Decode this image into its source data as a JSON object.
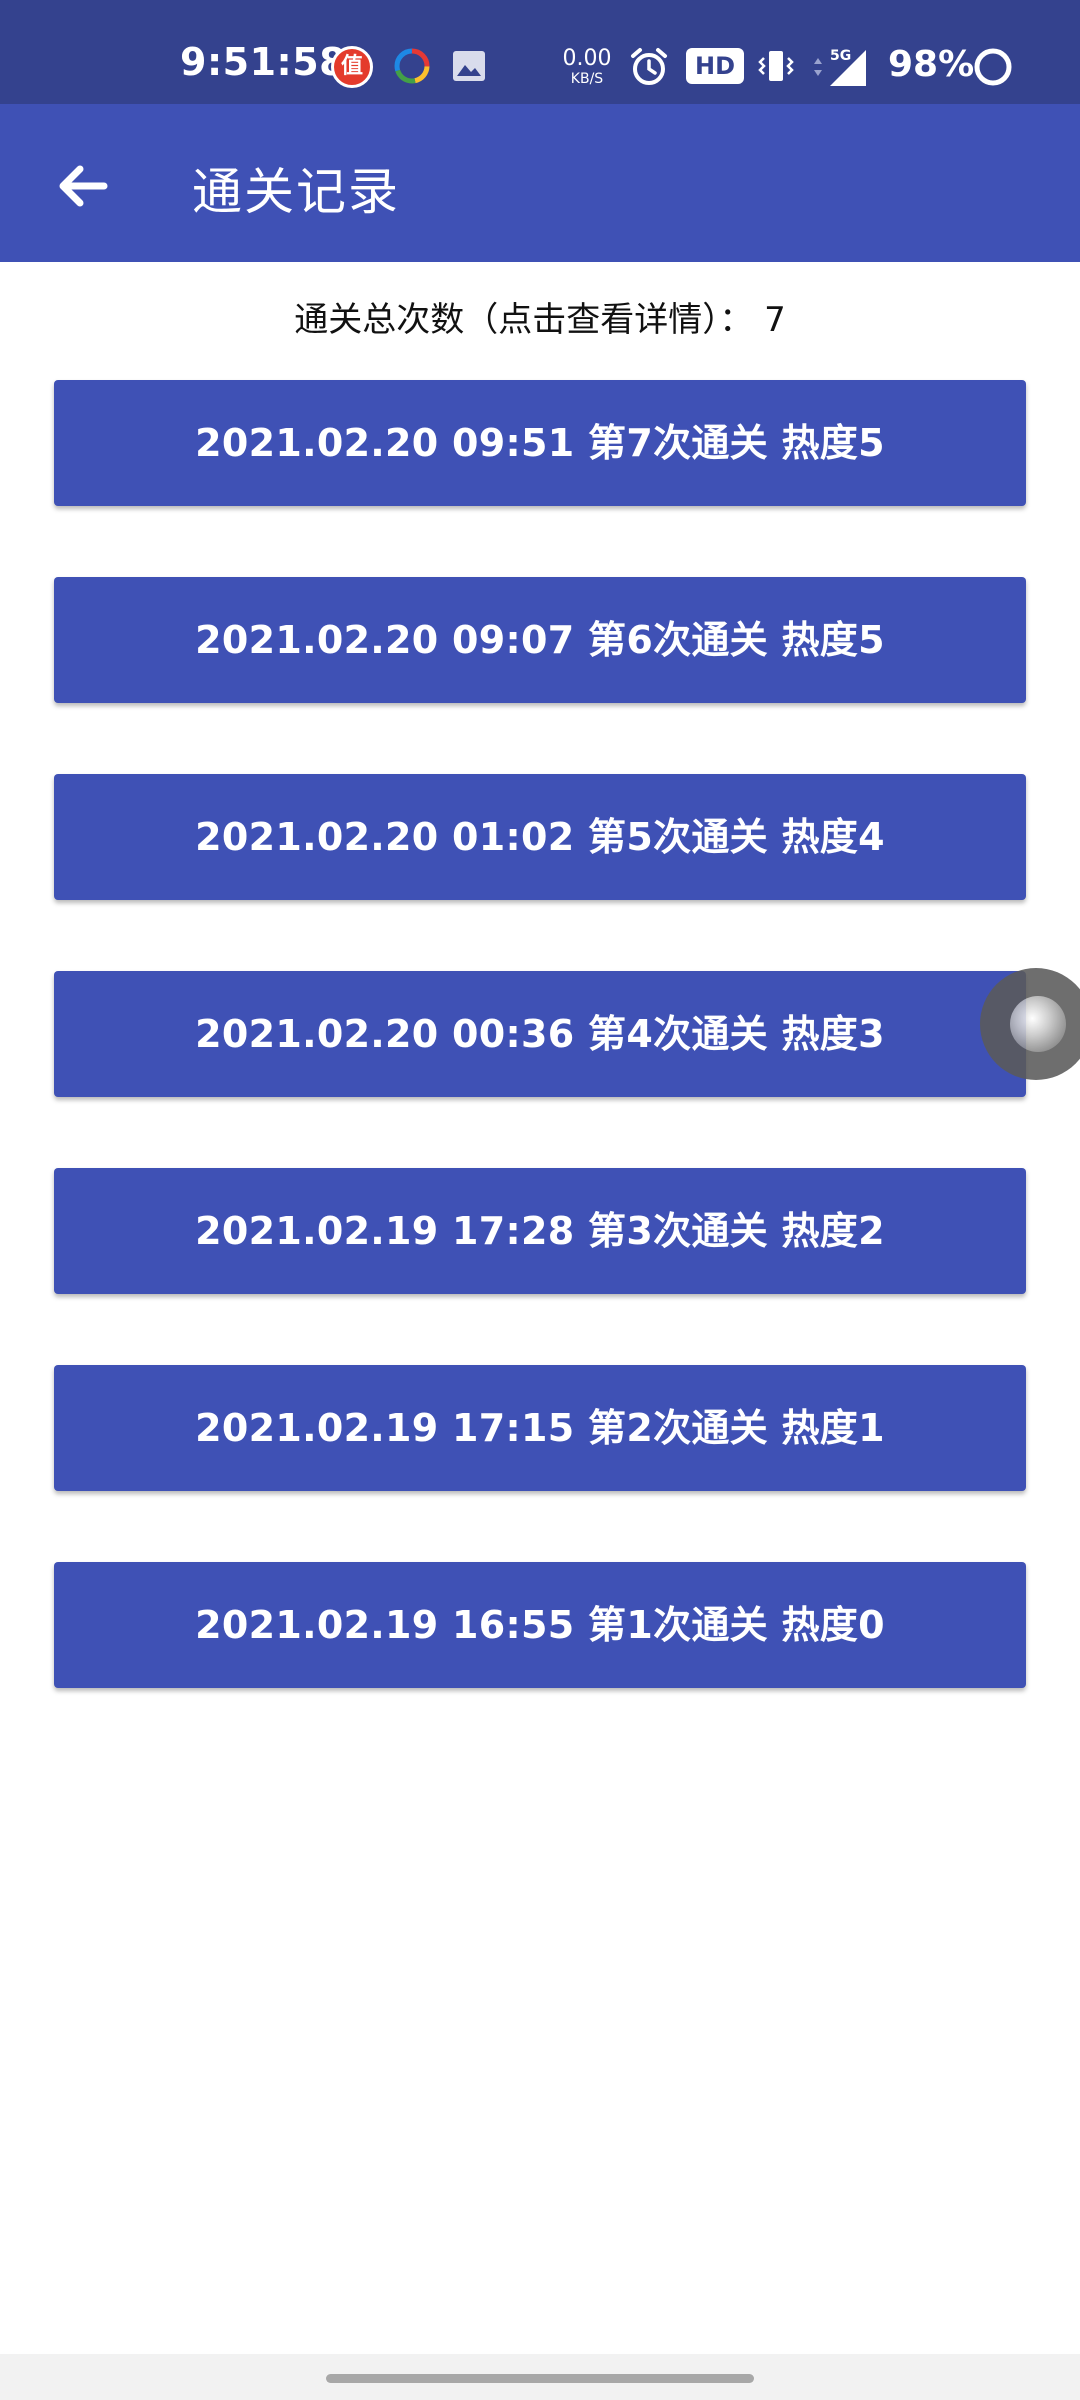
{
  "status_bar": {
    "time": "9:51:58",
    "zhi_badge": "值",
    "net_speed_value": "0.00",
    "net_speed_unit": "KB/S",
    "hd_badge": "HD",
    "signal_label": "5G",
    "battery_percent": "98%",
    "icons": [
      "zhi-app-icon",
      "ring-app-icon",
      "image-icon",
      "alarm-icon",
      "vibrate-icon",
      "signal-icon",
      "battery-icon"
    ]
  },
  "app_bar": {
    "back_icon": "arrow-left-icon",
    "title": "通关记录"
  },
  "summary": {
    "text": "通关总次数（点击查看详情）：  7"
  },
  "records": [
    {
      "label": "2021.02.20 09:51 第7次通关 热度5"
    },
    {
      "label": "2021.02.20 09:07 第6次通关 热度5"
    },
    {
      "label": "2021.02.20 01:02 第5次通关 热度4"
    },
    {
      "label": "2021.02.20 00:36 第4次通关 热度3"
    },
    {
      "label": "2021.02.19 17:28 第3次通关 热度2"
    },
    {
      "label": "2021.02.19 17:15 第2次通关 热度1"
    },
    {
      "label": "2021.02.19 16:55 第1次通关 热度0"
    }
  ],
  "colors": {
    "status_bar": "#34428e",
    "primary": "#3f51b5",
    "background": "#ffffff",
    "nav_bar": "#f2f2f2"
  }
}
